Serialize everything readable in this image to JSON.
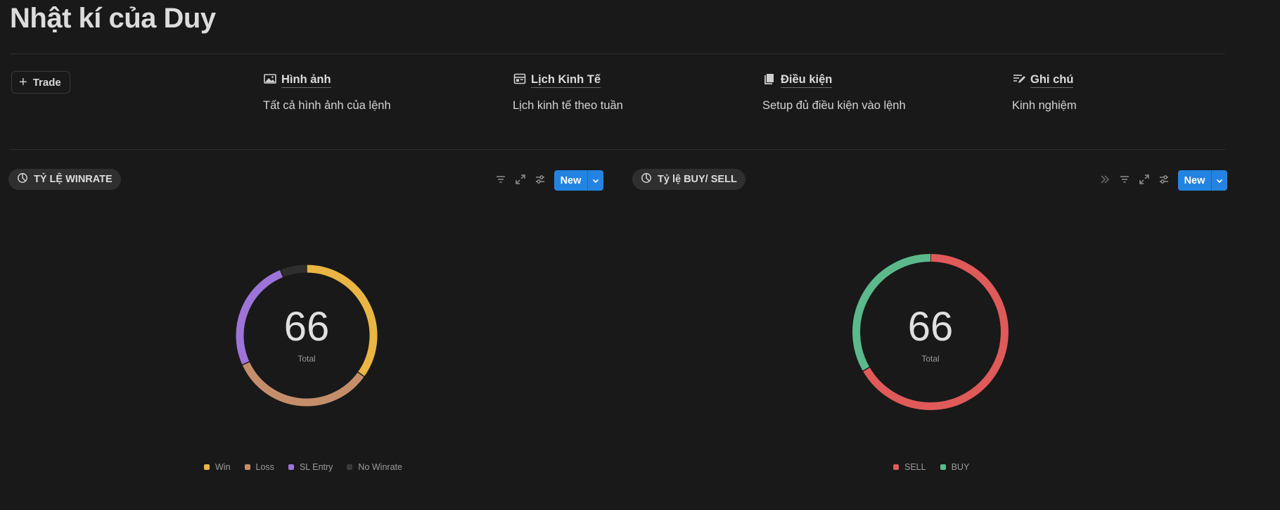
{
  "page": {
    "title": "Nhật kí của Duy"
  },
  "toolbar": {
    "trade_label": "Trade"
  },
  "links": [
    {
      "icon": "image-icon",
      "title": "Hình ảnh",
      "desc": "Tất cả hình ảnh của lệnh"
    },
    {
      "icon": "calendar-layout-icon",
      "title": "Lịch Kinh Tế",
      "desc": "Lịch kinh tế theo tuần"
    },
    {
      "icon": "book-icon",
      "title": "Điều kiện",
      "desc": "Setup đủ điều kiện vào lệnh"
    },
    {
      "icon": "note-edit-icon",
      "title": "Ghi chú",
      "desc": "Kinh nghiệm"
    }
  ],
  "views": [
    {
      "tab_label": "TỶ LỆ WINRATE",
      "new_label": "New",
      "center_value": "66",
      "center_label": "Total"
    },
    {
      "tab_label": "Tỷ lệ BUY/ SELL",
      "new_label": "New",
      "center_value": "66",
      "center_label": "Total"
    }
  ],
  "chart_data": [
    {
      "type": "pie",
      "total": 66,
      "categories": [
        "Win",
        "Loss",
        "SL Entry",
        "No Winrate"
      ],
      "values": [
        23,
        22,
        17,
        4
      ],
      "colors": [
        "#eab543",
        "#c58e6b",
        "#9d74d8",
        "#2e2e2e"
      ]
    },
    {
      "type": "pie",
      "total": 66,
      "categories": [
        "SELL",
        "BUY"
      ],
      "values": [
        44,
        22
      ],
      "colors": [
        "#e05a5a",
        "#5bb98b"
      ]
    }
  ]
}
